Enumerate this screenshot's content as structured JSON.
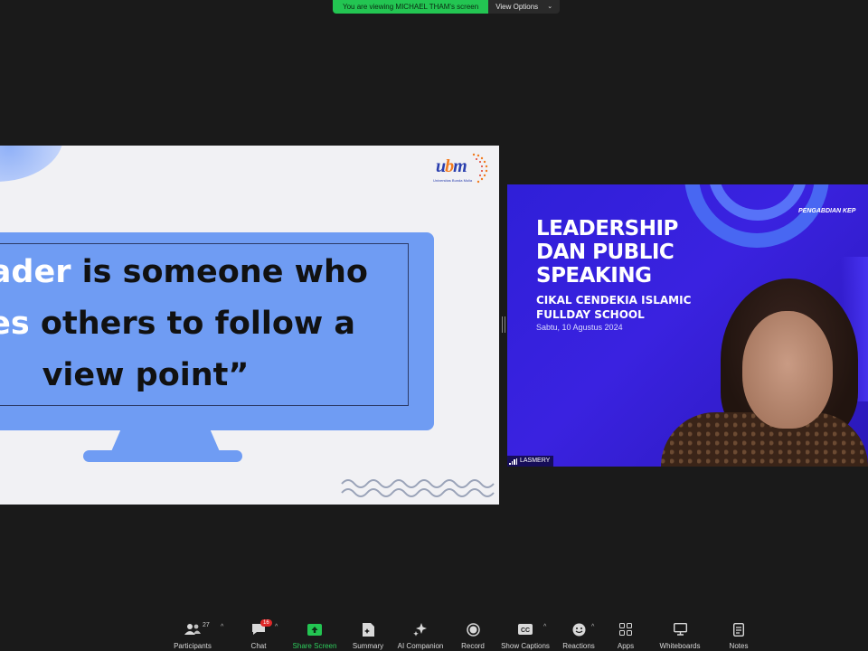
{
  "top_banner": {
    "viewing_text": "You are viewing MICHAEL THAM's screen",
    "view_options_label": "View Options",
    "view_options_icon": "chevron-down-icon"
  },
  "slide": {
    "logo_text_u": "u",
    "logo_text_b": "b",
    "logo_text_m": "m",
    "logo_subtitle": "Universitas Bunda Mulia",
    "quote": {
      "line1_highlight": "eader",
      "line1_rest": " is someone who",
      "line2_highlight": "ires",
      "line2_rest": " others to follow a",
      "line3": "view point”"
    }
  },
  "video": {
    "title_lines": [
      "LEADERSHIP",
      "DAN PUBLIC",
      "SPEAKING"
    ],
    "school_lines": [
      "CIKAL CENDEKIA ISLAMIC",
      "FULLDAY SCHOOL"
    ],
    "date": "Sabtu, 10 Agustus 2024",
    "corner_text": "PENGABDIAN KEP",
    "participant_name": "LASMERY"
  },
  "toolbar": {
    "participants": {
      "label": "Participants",
      "count": "27",
      "icon": "participants-icon"
    },
    "chat": {
      "label": "Chat",
      "badge": "16",
      "icon": "chat-icon"
    },
    "share_screen": {
      "label": "Share Screen",
      "icon": "share-screen-icon"
    },
    "summary": {
      "label": "Summary",
      "icon": "summary-icon"
    },
    "ai_companion": {
      "label": "AI Companion",
      "icon": "sparkle-icon"
    },
    "record": {
      "label": "Record",
      "icon": "record-icon"
    },
    "show_captions": {
      "label": "Show Captions",
      "icon": "captions-icon"
    },
    "reactions": {
      "label": "Reactions",
      "icon": "emoji-icon"
    },
    "apps": {
      "label": "Apps",
      "icon": "apps-icon"
    },
    "whiteboards": {
      "label": "Whiteboards",
      "icon": "whiteboard-icon"
    },
    "notes": {
      "label": "Notes",
      "icon": "notes-icon"
    },
    "caret": "^"
  },
  "colors": {
    "background": "#1a1a1a",
    "banner_green": "#23c552",
    "share_green": "#2ecc5c",
    "slide_blue": "#6f9cf3",
    "video_purple": "#3a22e0",
    "badge_red": "#e02828"
  }
}
